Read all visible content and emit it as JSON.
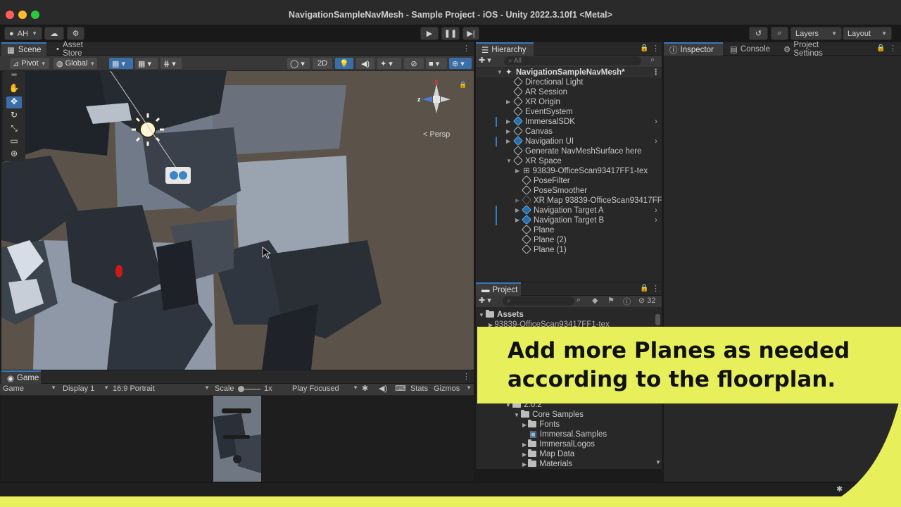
{
  "window": {
    "title": "NavigationSampleNavMesh - Sample Project - iOS - Unity 2022.3.10f1 <Metal>"
  },
  "toolbar": {
    "account": "AH",
    "layers": "Layers",
    "layout": "Layout"
  },
  "scene_panel": {
    "tabs": [
      "Scene",
      "Asset Store"
    ],
    "pivot": "Pivot",
    "global": "Global",
    "mode_2d": "2D",
    "persp_label": "< Persp",
    "gizmo_axes": {
      "x": "x",
      "y": "y",
      "z": "z"
    }
  },
  "hierarchy": {
    "tab": "Hierarchy",
    "search_placeholder": "All",
    "scene_name": "NavigationSampleNavMesh*",
    "items": [
      {
        "label": "Directional Light"
      },
      {
        "label": "AR Session"
      },
      {
        "label": "XR Origin"
      },
      {
        "label": "EventSystem"
      },
      {
        "label": "ImmersalSDK"
      },
      {
        "label": "Canvas"
      },
      {
        "label": "Navigation UI"
      },
      {
        "label": "Generate NavMeshSurface here"
      },
      {
        "label": "XR Space"
      },
      {
        "label": "93839-OfficeScan93417FF1-tex"
      },
      {
        "label": "PoseFilter"
      },
      {
        "label": "PoseSmoother"
      },
      {
        "label": "XR Map 93839-OfficeScan93417FF1"
      },
      {
        "label": "Navigation Target A"
      },
      {
        "label": "Navigation Target B"
      },
      {
        "label": "Plane"
      },
      {
        "label": "Plane (2)"
      },
      {
        "label": "Plane (1)"
      }
    ]
  },
  "inspector_panel": {
    "tabs": [
      "Inspector",
      "Console",
      "Project Settings"
    ]
  },
  "project": {
    "tab": "Project",
    "hidden_count": "32",
    "assets_root": "Assets",
    "first_item": "93839-OfficeScan93417FF1-tex",
    "items": [
      {
        "label": "2.0.2"
      },
      {
        "label": "Core Samples"
      },
      {
        "label": "Fonts"
      },
      {
        "label": "Immersal.Samples"
      },
      {
        "label": "ImmersalLogos"
      },
      {
        "label": "Map Data"
      },
      {
        "label": "Materials"
      }
    ]
  },
  "game_panel": {
    "tab": "Game",
    "view_select": "Game",
    "display": "Display 1",
    "aspect": "16:9 Portrait",
    "scale_label": "Scale",
    "scale_value": "1x",
    "play_mode": "Play Focused",
    "stats": "Stats",
    "gizmos": "Gizmos"
  },
  "banner": {
    "line1": "Add more Planes as needed",
    "line2": "according to the floorplan."
  },
  "colors": {
    "accent": "#3a79bb",
    "banner": "#e7f05a",
    "prefab_text": "#7fb4ee",
    "scene_ground": "#5a5248"
  }
}
